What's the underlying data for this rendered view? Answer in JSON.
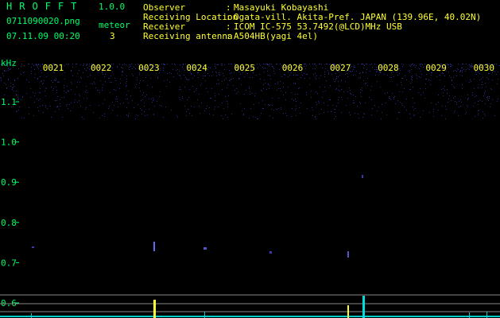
{
  "app": {
    "title": "HROFFT",
    "version": "1.0.0"
  },
  "file_name": "0711090020.png",
  "datetime": "07.11.09 00:20",
  "meteor": {
    "label": "meteor",
    "count": "3"
  },
  "info": [
    {
      "key": "Observer",
      "value": "Masayuki Kobayashi"
    },
    {
      "key": "Receiving Location",
      "value": "Ogata-vill. Akita-Pref. JAPAN (139.96E, 40.02N)"
    },
    {
      "key": "Receiver",
      "value": "ICOM IC-575 53.7492(@LCD)MHz USB"
    },
    {
      "key": "Receiving antenna",
      "value": "A504HB(yagi 4el)"
    }
  ],
  "colors": {
    "text": "#00ff66",
    "highlight": "#ffff33",
    "trace": "#00cccc",
    "background": "#000000",
    "noise": "#2a2a88"
  },
  "chart_data": {
    "type": "heatmap",
    "y_unit": "kHz",
    "x_ticks": [
      "0021",
      "0022",
      "0023",
      "0024",
      "0025",
      "0026",
      "0027",
      "0028",
      "0029",
      "0030"
    ],
    "y_ticks": [
      "1.1",
      "1.0",
      "0.9",
      "0.8",
      "0.7",
      "0.6"
    ]
  }
}
